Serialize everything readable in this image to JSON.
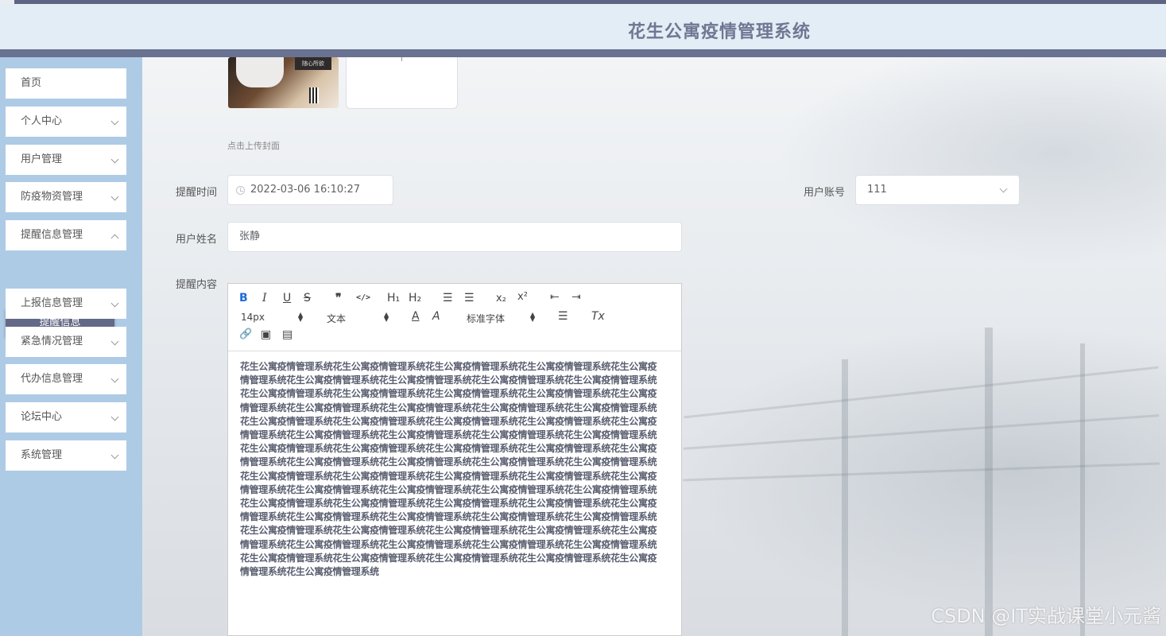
{
  "app": {
    "title": "花生公寓疫情管理系统"
  },
  "sidebar": {
    "items": [
      {
        "label": "首页"
      },
      {
        "label": "个人中心"
      },
      {
        "label": "用户管理"
      },
      {
        "label": "防疫物资管理"
      },
      {
        "label": "提醒信息管理"
      },
      {
        "label": "上报信息管理"
      },
      {
        "label": "紧急情况管理"
      },
      {
        "label": "代办信息管理"
      },
      {
        "label": "论坛中心"
      },
      {
        "label": "系统管理"
      }
    ],
    "active_sub": "提醒信息"
  },
  "form": {
    "cover_thumb_tag": "随心所欲",
    "upload_tip": "点击上传封面",
    "remind_time_label": "提醒时间",
    "remind_time_value": "2022-03-06 16:10:27",
    "account_label": "用户账号",
    "account_value": "111",
    "name_label": "用户姓名",
    "name_value": "张静",
    "content_label": "提醒内容"
  },
  "editor": {
    "toolbar": {
      "bold": "B",
      "italic": "I",
      "underline": "U",
      "strike": "S",
      "quote": "❞",
      "code": "</>",
      "h1": "H₁",
      "h2": "H₂",
      "ordered_list": "☰",
      "bullet_list": "☰",
      "subscript": "x₂",
      "superscript": "x²",
      "outdent": "⇤",
      "indent": "⇥",
      "size_value": "14px",
      "header_value": "文本",
      "font_value": "标准字体",
      "color": "A",
      "background": "A",
      "align": "☰",
      "clean": "Tx",
      "link": "🔗",
      "image": "▣",
      "video": "▤"
    },
    "content": "花生公寓疫情管理系统花生公寓疫情管理系统花生公寓疫情管理系统花生公寓疫情管理系统花生公寓疫情管理系统花生公寓疫情管理系统花生公寓疫情管理系统花生公寓疫情管理系统花生公寓疫情管理系统花生公寓疫情管理系统花生公寓疫情管理系统花生公寓疫情管理系统花生公寓疫情管理系统花生公寓疫情管理系统花生公寓疫情管理系统花生公寓疫情管理系统花生公寓疫情管理系统花生公寓疫情管理系统花生公寓疫情管理系统花生公寓疫情管理系统花生公寓疫情管理系统花生公寓疫情管理系统花生公寓疫情管理系统花生公寓疫情管理系统花生公寓疫情管理系统花生公寓疫情管理系统花生公寓疫情管理系统花生公寓疫情管理系统花生公寓疫情管理系统花生公寓疫情管理系统花生公寓疫情管理系统花生公寓疫情管理系统花生公寓疫情管理系统花生公寓疫情管理系统花生公寓疫情管理系统花生公寓疫情管理系统花生公寓疫情管理系统花生公寓疫情管理系统花生公寓疫情管理系统花生公寓疫情管理系统花生公寓疫情管理系统花生公寓疫情管理系统花生公寓疫情管理系统花生公寓疫情管理系统花生公寓疫情管理系统花生公寓疫情管理系统花生公寓疫情管理系统花生公寓疫情管理系统花生公寓疫情管理系统花生公寓疫情管理系统花生公寓疫情管理系统花生公寓疫情管理系统花生公寓疫情管理系统花生公寓疫情管理系统花生公寓疫情管理系统花生公寓疫情管理系统花生公寓疫情管理系统花生公寓疫情管理系统花生公寓疫情管理系统花生公寓疫情管理系统花生公寓疫情管理系统花生公寓疫情管理系统花生公寓疫情管理系统花生公寓疫情管理系统花生公寓疫情管理系统花生公寓疫情管理系统花生公寓疫情管理系统花生公寓疫情管理系统花生公寓疫情管理系统"
  },
  "watermark": "CSDN @IT实战课堂小元酱"
}
